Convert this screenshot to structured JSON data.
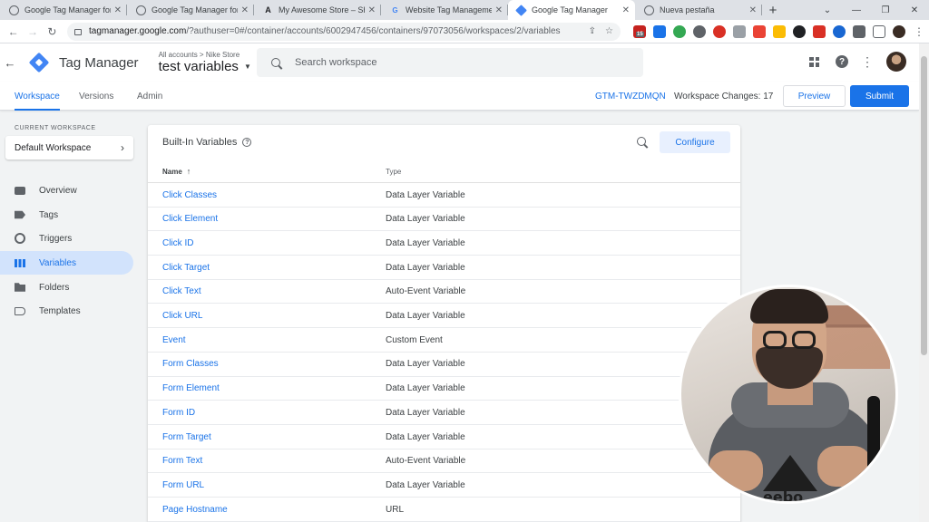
{
  "browser": {
    "tabs": [
      {
        "title": "Google Tag Manager for W",
        "favicon": "globe-icon",
        "active": false
      },
      {
        "title": "Google Tag Manager for W",
        "favicon": "globe-icon",
        "active": false
      },
      {
        "title": "My Awesome Store – Shop",
        "favicon": "ai-logo-icon",
        "active": false
      },
      {
        "title": "Website Tag Management",
        "favicon": "google-g-icon",
        "active": false
      },
      {
        "title": "Google Tag Manager",
        "favicon": "gtm-icon",
        "active": true
      },
      {
        "title": "Nueva pestaña",
        "favicon": "globe-icon",
        "active": false
      }
    ],
    "url_host": "tagmanager.google.com",
    "url_path": "/?authuser=0#/container/accounts/6002947456/containers/97073056/workspaces/2/variables",
    "ext_badge": "15"
  },
  "header": {
    "product": "Tag Manager",
    "breadcrumb": "All accounts > Nike Store",
    "container_name": "test variables",
    "search_placeholder": "Search workspace"
  },
  "nav": {
    "tabs": [
      "Workspace",
      "Versions",
      "Admin"
    ],
    "active_tab": "Workspace",
    "container_id": "GTM-TWZDMQN",
    "workspace_changes": "Workspace Changes: 17",
    "preview_label": "Preview",
    "submit_label": "Submit"
  },
  "sidebar": {
    "current_workspace_label": "CURRENT WORKSPACE",
    "workspace_name": "Default Workspace",
    "items": [
      {
        "label": "Overview",
        "icon": "overview-icon"
      },
      {
        "label": "Tags",
        "icon": "tag-icon"
      },
      {
        "label": "Triggers",
        "icon": "trigger-icon"
      },
      {
        "label": "Variables",
        "icon": "variables-icon",
        "active": true
      },
      {
        "label": "Folders",
        "icon": "folder-icon"
      },
      {
        "label": "Templates",
        "icon": "template-icon"
      }
    ]
  },
  "card": {
    "title": "Built-In Variables",
    "configure_label": "Configure",
    "col_name": "Name",
    "col_type": "Type",
    "rows": [
      {
        "name": "Click Classes",
        "type": "Data Layer Variable"
      },
      {
        "name": "Click Element",
        "type": "Data Layer Variable"
      },
      {
        "name": "Click ID",
        "type": "Data Layer Variable"
      },
      {
        "name": "Click Target",
        "type": "Data Layer Variable"
      },
      {
        "name": "Click Text",
        "type": "Auto-Event Variable"
      },
      {
        "name": "Click URL",
        "type": "Data Layer Variable"
      },
      {
        "name": "Event",
        "type": "Custom Event"
      },
      {
        "name": "Form Classes",
        "type": "Data Layer Variable"
      },
      {
        "name": "Form Element",
        "type": "Data Layer Variable"
      },
      {
        "name": "Form ID",
        "type": "Data Layer Variable"
      },
      {
        "name": "Form Target",
        "type": "Data Layer Variable"
      },
      {
        "name": "Form Text",
        "type": "Auto-Event Variable"
      },
      {
        "name": "Form URL",
        "type": "Data Layer Variable"
      },
      {
        "name": "Page Hostname",
        "type": "URL"
      }
    ]
  },
  "webcam": {
    "shirt_text": "eebo"
  },
  "colors": {
    "accent": "#1a73e8",
    "active_bg": "#d2e3fc"
  }
}
